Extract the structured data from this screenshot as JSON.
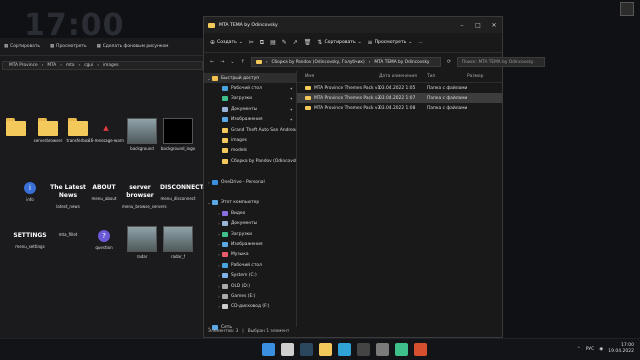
{
  "background": {
    "clock": "17:00",
    "toolbar": [
      {
        "label": "Сортировать",
        "icon": "sort-icon"
      },
      {
        "label": "Просмотреть",
        "icon": "view-icon"
      },
      {
        "label": "Сделать фоновым рисунком",
        "icon": "wallpaper-icon"
      }
    ],
    "path": [
      "MTA Province",
      "MTA",
      "mta",
      "cgui",
      "images"
    ],
    "items": [
      {
        "label": "",
        "type": "folder"
      },
      {
        "label": "serverbrowser",
        "type": "folder"
      },
      {
        "label": "transferbox",
        "type": "folder"
      },
      {
        "label": "16-message-warn",
        "type": "warn"
      },
      {
        "label": "background",
        "type": "thumb"
      },
      {
        "label": "background_logo",
        "type": "black"
      },
      {
        "label": "info",
        "type": "info"
      },
      {
        "label": "latest_news",
        "type": "text",
        "big": "The Latest News"
      },
      {
        "label": "menu_about",
        "type": "text",
        "big": "ABOUT"
      },
      {
        "label": "menu_browse_servers",
        "type": "text",
        "big": "server browser"
      },
      {
        "label": "menu_disconnect",
        "type": "text",
        "big": "DISCONNECT"
      },
      {
        "label": "menu_settings",
        "type": "text",
        "big": "SETTINGS"
      },
      {
        "label": "mta_fillet",
        "type": "text",
        "big": ""
      },
      {
        "label": "question",
        "type": "question"
      },
      {
        "label": "radar",
        "type": "thumb"
      },
      {
        "label": "radar_f",
        "type": "thumb"
      }
    ]
  },
  "explorer": {
    "title": "MTA TEMA by Odincovsky",
    "toolbar": {
      "create": "Создать",
      "sort": "Сортировать",
      "view": "Просмотреть",
      "more": "..."
    },
    "address": [
      "Сборка by Pandov (Odincovsky, Голубчик)",
      "MTA TEMA by Odincovsky"
    ],
    "search_placeholder": "Поиск: MTA TEMA by Odincovsky",
    "sidebar": [
      {
        "label": "Быстрый доступ",
        "icon": "star-icon",
        "color": "#f2c14e",
        "indent": 0,
        "selected": true,
        "chev": "v"
      },
      {
        "label": "Рабочий стол",
        "icon": "desktop-icon",
        "color": "#4aa3df",
        "indent": 1,
        "pin": true
      },
      {
        "label": "Загрузки",
        "icon": "download-icon",
        "color": "#3fbf8a",
        "indent": 1,
        "pin": true
      },
      {
        "label": "Документы",
        "icon": "document-icon",
        "color": "#9ab4d8",
        "indent": 1,
        "pin": true
      },
      {
        "label": "Изображения",
        "icon": "pictures-icon",
        "color": "#5aa9e6",
        "indent": 1,
        "pin": true
      },
      {
        "label": "Grand Theft Auto San Andreas",
        "icon": "folder-icon",
        "color": "#f4c95b",
        "indent": 1
      },
      {
        "label": "images",
        "icon": "folder-icon",
        "color": "#f4c95b",
        "indent": 1
      },
      {
        "label": "models",
        "icon": "folder-icon",
        "color": "#f4c95b",
        "indent": 1
      },
      {
        "label": "Сборка by Pandov (Odincovsky, Голубчик)",
        "icon": "folder-icon",
        "color": "#f4c95b",
        "indent": 1
      },
      {
        "label": "",
        "icon": "",
        "color": "",
        "indent": 0
      },
      {
        "label": "OneDrive - Personal",
        "icon": "cloud-icon",
        "color": "#3b8fe0",
        "indent": 0,
        "chev": ">"
      },
      {
        "label": "",
        "icon": "",
        "color": "",
        "indent": 0
      },
      {
        "label": "Этот компьютер",
        "icon": "computer-icon",
        "color": "#5aa9e6",
        "indent": 0,
        "chev": "v"
      },
      {
        "label": "Видео",
        "icon": "video-icon",
        "color": "#8a6fdf",
        "indent": 1,
        "chev": ">"
      },
      {
        "label": "Документы",
        "icon": "document-icon",
        "color": "#9ab4d8",
        "indent": 1,
        "chev": ">"
      },
      {
        "label": "Загрузки",
        "icon": "download-icon",
        "color": "#3fbf8a",
        "indent": 1,
        "chev": ">"
      },
      {
        "label": "Изображения",
        "icon": "pictures-icon",
        "color": "#5aa9e6",
        "indent": 1,
        "chev": ">"
      },
      {
        "label": "Музыка",
        "icon": "music-icon",
        "color": "#e65a6a",
        "indent": 1,
        "chev": ">"
      },
      {
        "label": "Рабочий стол",
        "icon": "desktop-icon",
        "color": "#4aa3df",
        "indent": 1,
        "chev": ">"
      },
      {
        "label": "System (C:)",
        "icon": "drive-icon",
        "color": "#7fb2e8",
        "indent": 1,
        "chev": ">"
      },
      {
        "label": "OLD (D:)",
        "icon": "drive-icon",
        "color": "#aaaaaa",
        "indent": 1,
        "chev": ">"
      },
      {
        "label": "Games (E:)",
        "icon": "drive-icon",
        "color": "#aaaaaa",
        "indent": 1,
        "chev": ">"
      },
      {
        "label": "CD-дисковод (F:)",
        "icon": "cd-icon",
        "color": "#cccccc",
        "indent": 1,
        "chev": ">"
      },
      {
        "label": "",
        "icon": "",
        "color": "",
        "indent": 0
      },
      {
        "label": "Сеть",
        "icon": "network-icon",
        "color": "#5aa9e6",
        "indent": 0,
        "chev": ">"
      }
    ],
    "columns": [
      "Имя",
      "Дата изменения",
      "Тип",
      "Размер"
    ],
    "files": [
      {
        "name": "MTA Province Themes Pack v1",
        "date": "03.04.2022 1:05",
        "type": "Папка с файлами",
        "size": "",
        "selected": false
      },
      {
        "name": "MTA Province Themes Pack v2",
        "date": "03.04.2022 1:07",
        "type": "Папка с файлами",
        "size": "",
        "selected": true
      },
      {
        "name": "MTA Province Themes Pack v3",
        "date": "03.04.2022 1:08",
        "type": "Папка с файлами",
        "size": "",
        "selected": false
      }
    ],
    "status": {
      "count": "Элементов: 3",
      "selected": "Выбран 1 элемент"
    }
  },
  "taskbar": {
    "apps": [
      {
        "name": "windows-start-icon",
        "color": "#3b8fe0"
      },
      {
        "name": "search-icon",
        "color": "#cfcfcf"
      },
      {
        "name": "steam-icon",
        "color": "#2a475e"
      },
      {
        "name": "file-explorer-icon",
        "color": "#f4c95b"
      },
      {
        "name": "edge-icon",
        "color": "#2fa3d6"
      },
      {
        "name": "app-icon-1",
        "color": "#444"
      },
      {
        "name": "store-icon",
        "color": "#7a7a7a"
      },
      {
        "name": "app-icon-2",
        "color": "#3fbf8a"
      },
      {
        "name": "app-icon-3",
        "color": "#d6502f"
      }
    ],
    "lang": "РУС",
    "time": "17:00",
    "date": "19.04.2022"
  }
}
